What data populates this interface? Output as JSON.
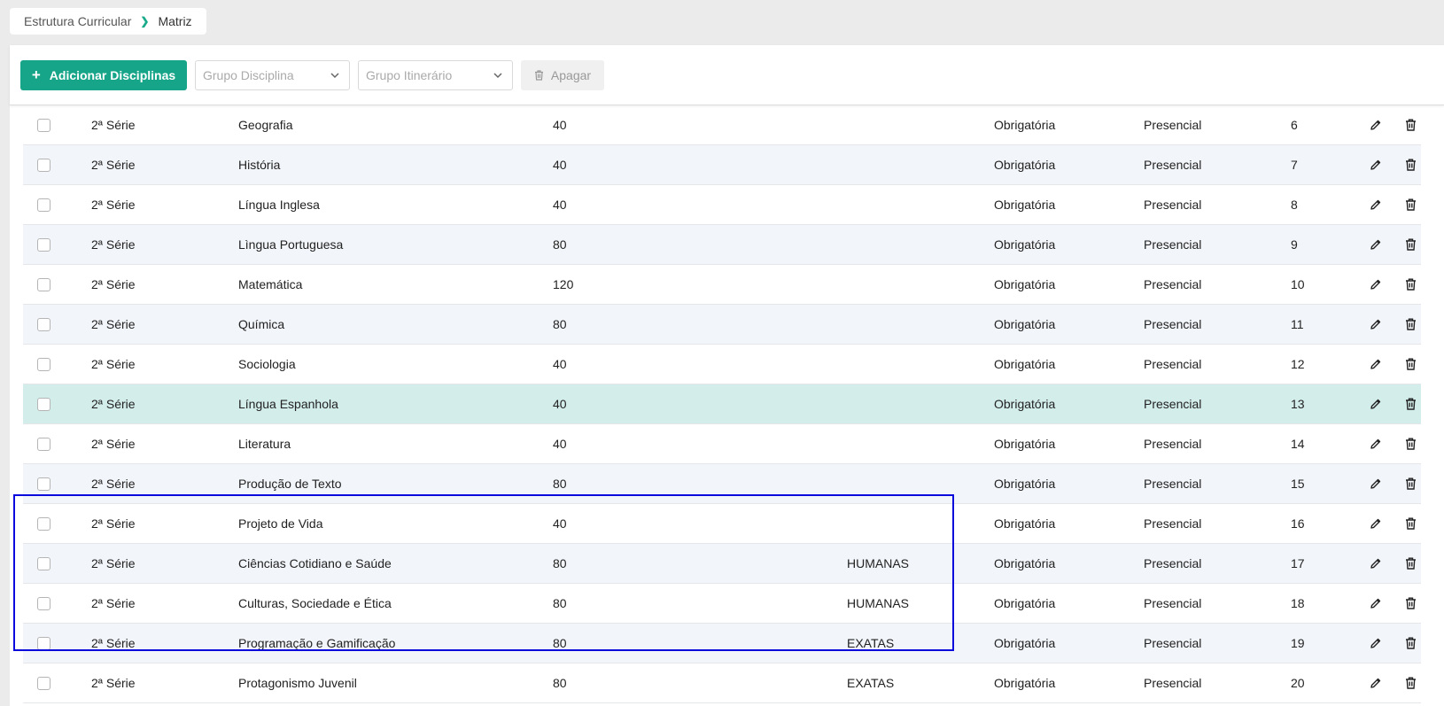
{
  "breadcrumb": {
    "root": "Estrutura Curricular",
    "current": "Matriz"
  },
  "toolbar": {
    "add_label": "Adicionar Disciplinas",
    "grupo_disciplina_placeholder": "Grupo Disciplina",
    "grupo_itinerario_placeholder": "Grupo Itinerário",
    "delete_label": "Apagar"
  },
  "colors": {
    "accent": "#16a589",
    "row_alt": "#f2f5f9",
    "row_selected": "#d3edeb",
    "highlight_border": "#0a0adc"
  },
  "rows": [
    {
      "serie": "2ª Série",
      "disciplina": "Geografia",
      "ch": "40",
      "grupo": "",
      "tipo": "Obrigatória",
      "modalidade": "Presencial",
      "ordem": "6"
    },
    {
      "serie": "2ª Série",
      "disciplina": "História",
      "ch": "40",
      "grupo": "",
      "tipo": "Obrigatória",
      "modalidade": "Presencial",
      "ordem": "7"
    },
    {
      "serie": "2ª Série",
      "disciplina": "Língua Inglesa",
      "ch": "40",
      "grupo": "",
      "tipo": "Obrigatória",
      "modalidade": "Presencial",
      "ordem": "8"
    },
    {
      "serie": "2ª Série",
      "disciplina": "Lìngua Portuguesa",
      "ch": "80",
      "grupo": "",
      "tipo": "Obrigatória",
      "modalidade": "Presencial",
      "ordem": "9"
    },
    {
      "serie": "2ª Série",
      "disciplina": "Matemática",
      "ch": "120",
      "grupo": "",
      "tipo": "Obrigatória",
      "modalidade": "Presencial",
      "ordem": "10"
    },
    {
      "serie": "2ª Série",
      "disciplina": "Química",
      "ch": "80",
      "grupo": "",
      "tipo": "Obrigatória",
      "modalidade": "Presencial",
      "ordem": "11"
    },
    {
      "serie": "2ª Série",
      "disciplina": "Sociologia",
      "ch": "40",
      "grupo": "",
      "tipo": "Obrigatória",
      "modalidade": "Presencial",
      "ordem": "12"
    },
    {
      "serie": "2ª Série",
      "disciplina": "Língua Espanhola",
      "ch": "40",
      "grupo": "",
      "tipo": "Obrigatória",
      "modalidade": "Presencial",
      "ordem": "13"
    },
    {
      "serie": "2ª Série",
      "disciplina": "Literatura",
      "ch": "40",
      "grupo": "",
      "tipo": "Obrigatória",
      "modalidade": "Presencial",
      "ordem": "14"
    },
    {
      "serie": "2ª Série",
      "disciplina": "Produção de Texto",
      "ch": "80",
      "grupo": "",
      "tipo": "Obrigatória",
      "modalidade": "Presencial",
      "ordem": "15"
    },
    {
      "serie": "2ª Série",
      "disciplina": "Projeto de Vida",
      "ch": "40",
      "grupo": "",
      "tipo": "Obrigatória",
      "modalidade": "Presencial",
      "ordem": "16"
    },
    {
      "serie": "2ª Série",
      "disciplina": "Ciências Cotidiano e Saúde",
      "ch": "80",
      "grupo": "HUMANAS",
      "tipo": "Obrigatória",
      "modalidade": "Presencial",
      "ordem": "17"
    },
    {
      "serie": "2ª Série",
      "disciplina": "Culturas, Sociedade e Ética",
      "ch": "80",
      "grupo": "HUMANAS",
      "tipo": "Obrigatória",
      "modalidade": "Presencial",
      "ordem": "18"
    },
    {
      "serie": "2ª Série",
      "disciplina": "Programação e Gamificação",
      "ch": "80",
      "grupo": "EXATAS",
      "tipo": "Obrigatória",
      "modalidade": "Presencial",
      "ordem": "19"
    },
    {
      "serie": "2ª Série",
      "disciplina": "Protagonismo Juvenil",
      "ch": "80",
      "grupo": "EXATAS",
      "tipo": "Obrigatória",
      "modalidade": "Presencial",
      "ordem": "20"
    }
  ],
  "selected_row_index": 7,
  "highlighted_rows": [
    11,
    12,
    13,
    14
  ]
}
